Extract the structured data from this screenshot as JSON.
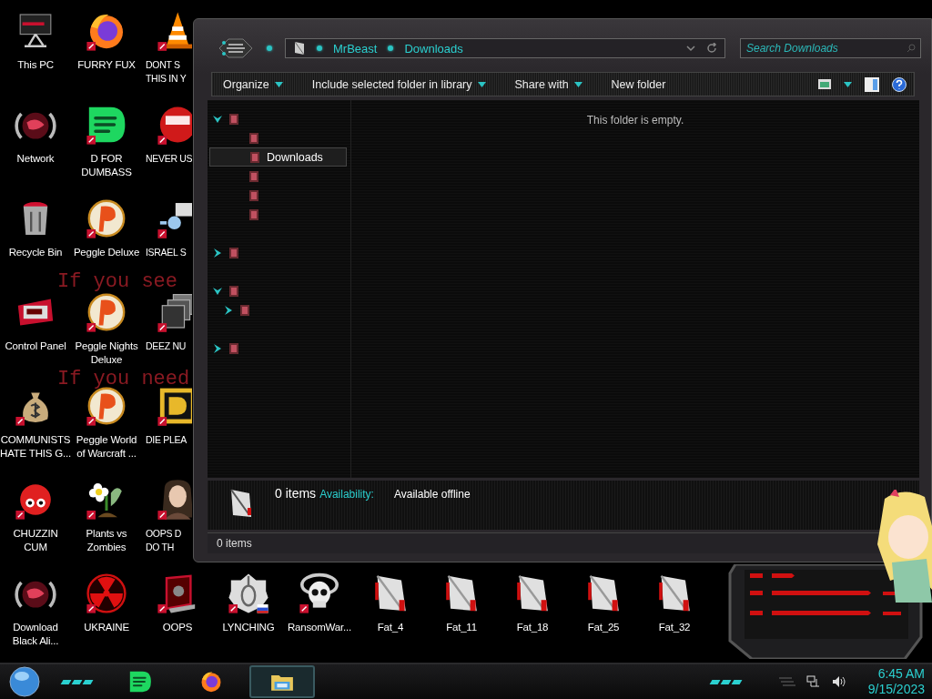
{
  "wallpaper_text": [
    "If you see",
    "If you need"
  ],
  "desktop_icons": [
    {
      "kind": "computer",
      "lines": [
        "This PC"
      ]
    },
    {
      "kind": "globe",
      "lines": [
        "Network"
      ]
    },
    {
      "kind": "bin",
      "lines": [
        "Recycle Bin"
      ]
    },
    {
      "kind": "panel",
      "lines": [
        "Control Panel"
      ]
    },
    {
      "kind": "bag",
      "lines": [
        "COMMUNISTS",
        "HATE THIS G..."
      ]
    },
    {
      "kind": "creature",
      "lines": [
        "CHUZZIN",
        "CUM"
      ]
    },
    {
      "kind": "fox",
      "lines": [
        "FURRY FUX"
      ]
    },
    {
      "kind": "lines",
      "lines": [
        "D FOR",
        "DUMBASS"
      ]
    },
    {
      "kind": "ball",
      "lines": [
        "Peggle Deluxe"
      ]
    },
    {
      "kind": "ball",
      "lines": [
        "Peggle Nights",
        "Deluxe"
      ]
    },
    {
      "kind": "ball",
      "lines": [
        "Peggle World",
        "of Warcraft ..."
      ]
    },
    {
      "kind": "flower",
      "lines": [
        "Plants vs",
        "Zombies"
      ]
    },
    {
      "kind": "cone",
      "lines": [
        "DONT S",
        "THIS IN Y"
      ]
    },
    {
      "kind": "disc",
      "lines": [
        "NEVER US"
      ]
    },
    {
      "kind": "plug",
      "lines": [
        "ISRAEL S"
      ]
    },
    {
      "kind": "stack",
      "lines": [
        "DEEZ NU"
      ]
    },
    {
      "kind": "tile",
      "lines": [
        "DIE PLEA"
      ]
    },
    {
      "kind": "person",
      "lines": [
        "OOPS D",
        "DO TH"
      ]
    }
  ],
  "bottom_icons": [
    {
      "kind": "globe",
      "lines": [
        "Download",
        "Black Ali..."
      ]
    },
    {
      "kind": "radiation",
      "lines": [
        "UKRAINE"
      ]
    },
    {
      "kind": "frame",
      "lines": [
        "OOPS"
      ]
    },
    {
      "kind": "knot",
      "lines": [
        "LYNCHING"
      ]
    },
    {
      "kind": "skull",
      "lines": [
        "RansomWar..."
      ]
    },
    {
      "kind": "file",
      "lines": [
        "Fat_4"
      ]
    },
    {
      "kind": "file",
      "lines": [
        "Fat_11"
      ]
    },
    {
      "kind": "file",
      "lines": [
        "Fat_18"
      ]
    },
    {
      "kind": "file",
      "lines": [
        "Fat_25"
      ]
    },
    {
      "kind": "file",
      "lines": [
        "Fat_32"
      ]
    }
  ],
  "explorer": {
    "breadcrumb": [
      "MrBeast",
      "Downloads"
    ],
    "search": {
      "placeholder": "Search Downloads"
    },
    "toolbar": [
      {
        "label": "Organize",
        "dropdown": true
      },
      {
        "label": "Include selected folder in library",
        "dropdown": true
      },
      {
        "label": "Share with",
        "dropdown": true
      },
      {
        "label": "New folder",
        "dropdown": false
      }
    ],
    "nav_tree": [
      {
        "selected": false,
        "expanded": true,
        "children": [
          {
            "selected": false
          },
          {
            "selected": true,
            "label": "Downloads"
          },
          {
            "selected": false
          },
          {
            "selected": false
          },
          {
            "selected": false
          }
        ]
      },
      {
        "selected": false,
        "expanded": false
      },
      {
        "selected": false,
        "expanded": true,
        "children": [
          {
            "selected": false,
            "expanded": false
          }
        ]
      },
      {
        "selected": false,
        "expanded": false
      }
    ],
    "empty_message": "This folder is empty.",
    "details": {
      "count": "0 items",
      "availability_label": "Availability:",
      "availability_value": "Available offline"
    },
    "status_bar": "0 items"
  },
  "taskbar": {
    "apps": [
      {
        "kind": "lines",
        "active": false
      },
      {
        "kind": "fox",
        "active": false
      },
      {
        "kind": "folder",
        "active": true
      }
    ],
    "time": "6:45 AM",
    "date": "9/15/2023"
  }
}
